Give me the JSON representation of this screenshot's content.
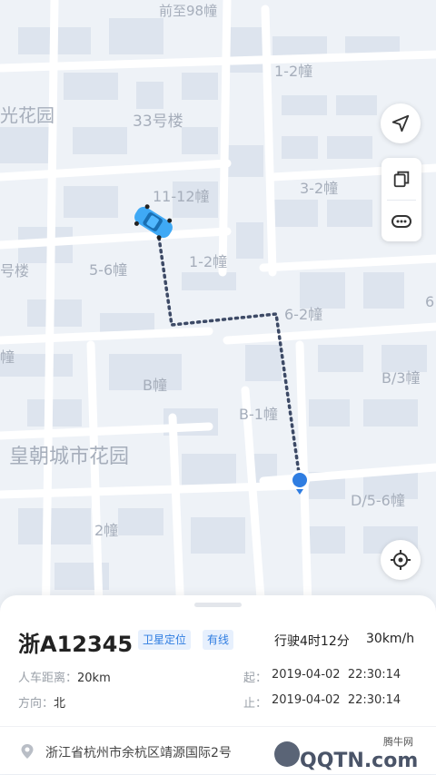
{
  "map": {
    "labels": {
      "top_cut": "前至98幢",
      "l_1_2_top": "1-2幢",
      "garden_left": "光花园",
      "b33": "33号楼",
      "l_11_12": "11-12幢",
      "l_3_2": "3-2幢",
      "l_5_6": "5-6幢",
      "l_1_2_mid": "1-2幢",
      "lou": "号楼",
      "l_6_2": "6-2幢",
      "l_6": "6",
      "zhuang": "幢",
      "b_zhuang": "B幢",
      "b3_zhuang": "B/3幢",
      "b1_zhuang": "B-1幢",
      "huangchao": "皇朝城市花园",
      "d56": "D/5-6幢",
      "l2": "2幢"
    }
  },
  "controls": {
    "locate_icon": "navigation-arrow",
    "copy_icon": "copy",
    "more_icon": "more-dots",
    "target_icon": "crosshair"
  },
  "vehicle": {
    "plate": "浙A12345",
    "badge_satellite": "卫星定位",
    "badge_wired": "有线",
    "drive_time": "行驶4时12分",
    "speed": "30km/h",
    "distance_label": "人车距离：",
    "distance_value": "20km",
    "direction_label": "方向：",
    "direction_value": "北",
    "start_label": "起：",
    "start_time": "2019-04-02  22:30:14",
    "end_label": "止：",
    "end_time": "2019-04-02  22:30:14",
    "address": "浙江省杭州市余杭区靖源国际2号"
  },
  "watermark": {
    "site": "腾牛网",
    "logo": "QQTN.com"
  },
  "colors": {
    "accent": "#2f7de1",
    "route": "#3d4a66",
    "car": "#3fa9f5"
  }
}
